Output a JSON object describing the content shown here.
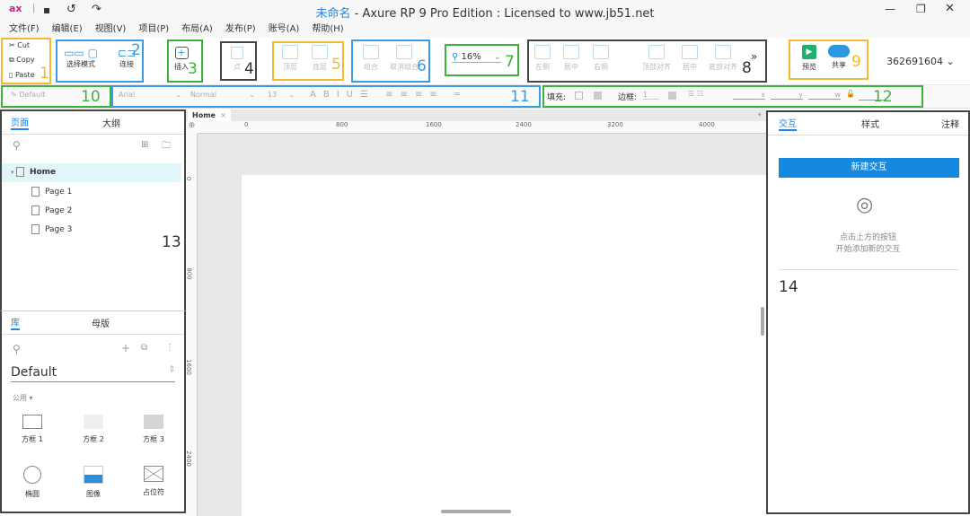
{
  "title": {
    "name": "未命名",
    "rest": " - Axure RP 9 Pro Edition : Licensed to www.jb51.net"
  },
  "logo": "ax",
  "menu": [
    "文件(F)",
    "编辑(E)",
    "视图(V)",
    "项目(P)",
    "布局(A)",
    "发布(P)",
    "账号(A)",
    "帮助(H)"
  ],
  "clipboard": {
    "cut": "Cut",
    "copy": "Copy",
    "paste": "Paste"
  },
  "toolbar": {
    "select_mode": "选择模式",
    "connect": "连接",
    "insert": "插入",
    "point": "点",
    "top": "顶层",
    "bottom": "底层",
    "group": "组合",
    "ungroup": "取消组合",
    "zoom": "16%",
    "align_left": "左侧",
    "align_center": "居中",
    "align_right": "右侧",
    "align_top": "顶部对齐",
    "align_middle": "居中",
    "align_bottom": "底部对齐",
    "more": "»",
    "preview": "预览",
    "share": "共享",
    "account": "362691604"
  },
  "format": {
    "style": "Default",
    "font": "Arial",
    "weight": "Normal",
    "size": "13",
    "fill": "填充:",
    "border": "边框:",
    "border_width": "1",
    "x": "x",
    "y": "y",
    "w": "w"
  },
  "annotations": [
    "1",
    "2",
    "3",
    "4",
    "5",
    "6",
    "7",
    "8",
    "9",
    "10",
    "11",
    "12",
    "13",
    "14"
  ],
  "pages_panel": {
    "tabs": [
      "页面",
      "大纲"
    ],
    "pages": [
      "Home",
      "Page 1",
      "Page 2",
      "Page 3"
    ]
  },
  "library_panel": {
    "tabs": [
      "库",
      "母版"
    ],
    "library": "Default",
    "category": "公用 ▾",
    "items": [
      "方框 1",
      "方框 2",
      "方框 3",
      "椭圆",
      "图像",
      "占位符"
    ]
  },
  "canvas": {
    "tab": "Home",
    "ruler_h": [
      "0",
      "800",
      "1600",
      "2400",
      "3200",
      "4000"
    ],
    "ruler_v": [
      "0",
      "800",
      "1600",
      "2400"
    ]
  },
  "right_panel": {
    "tabs": [
      "交互",
      "样式",
      "注释"
    ],
    "new_button": "新建交互",
    "hint1": "点击上方的按钮",
    "hint2": "开始添加新的交互"
  }
}
